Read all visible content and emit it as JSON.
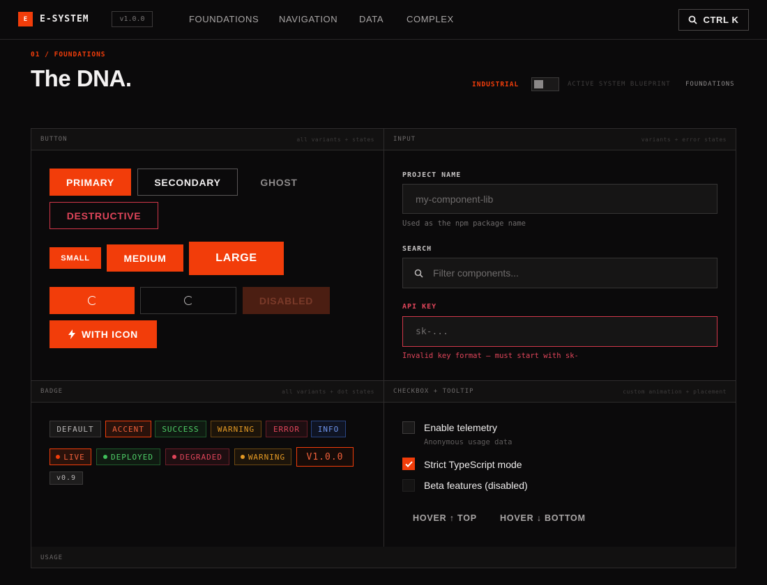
{
  "app": {
    "logo_letter": "E",
    "name": "E-SYSTEM",
    "version": "v1.0.0",
    "search_label": "CTRL K"
  },
  "nav": [
    "FOUNDATIONS",
    "NAVIGATION",
    "DATA",
    "COMPLEX"
  ],
  "header": {
    "breadcrumb": "01 / FOUNDATIONS",
    "title": "The DNA.",
    "mode_label": "INDUSTRIAL",
    "blueprint": "ACTIVE SYSTEM BLUEPRINT",
    "section": "FOUNDATIONS"
  },
  "button_panel": {
    "title": "BUTTON",
    "meta": "all variants + states",
    "variants": [
      "PRIMARY",
      "SECONDARY",
      "GHOST",
      "DESTRUCTIVE"
    ],
    "sizes": [
      "SMALL",
      "MEDIUM",
      "LARGE"
    ],
    "disabled": "DISABLED",
    "with_icon": "WITH ICON"
  },
  "input_panel": {
    "title": "INPUT",
    "meta": "variants + error states",
    "project": {
      "label": "PROJECT NAME",
      "placeholder": "my-component-lib",
      "hint": "Used as the npm package name"
    },
    "search": {
      "label": "SEARCH",
      "placeholder": "Filter components..."
    },
    "api": {
      "label": "API KEY",
      "placeholder": "sk-...",
      "error": "Invalid key format — must start with sk-"
    }
  },
  "badge_panel": {
    "title": "BADGE",
    "meta": "all variants + dot states",
    "row1": [
      "DEFAULT",
      "ACCENT",
      "SUCCESS",
      "WARNING",
      "ERROR",
      "INFO"
    ],
    "row2": [
      "LIVE",
      "DEPLOYED",
      "DEGRADED",
      "WARNING",
      "V1.0.0"
    ],
    "row3": [
      "v0.9"
    ]
  },
  "checkbox_panel": {
    "title": "CHECKBOX + TOOLTIP",
    "meta": "custom animation + placement",
    "items": [
      {
        "label": "Enable telemetry",
        "sub": "Anonymous usage data",
        "checked": false
      },
      {
        "label": "Strict TypeScript mode",
        "checked": true
      },
      {
        "label": "Beta features (disabled)",
        "checked": false
      }
    ],
    "tooltips": [
      "HOVER ↑ TOP",
      "HOVER ↓ BOTTOM"
    ]
  },
  "usage": {
    "title": "USAGE"
  },
  "colors": {
    "accent": "#f23d0a",
    "error": "#e0455a",
    "success": "#3fbf5a",
    "warning": "#e49a24",
    "info": "#5a86e8"
  }
}
